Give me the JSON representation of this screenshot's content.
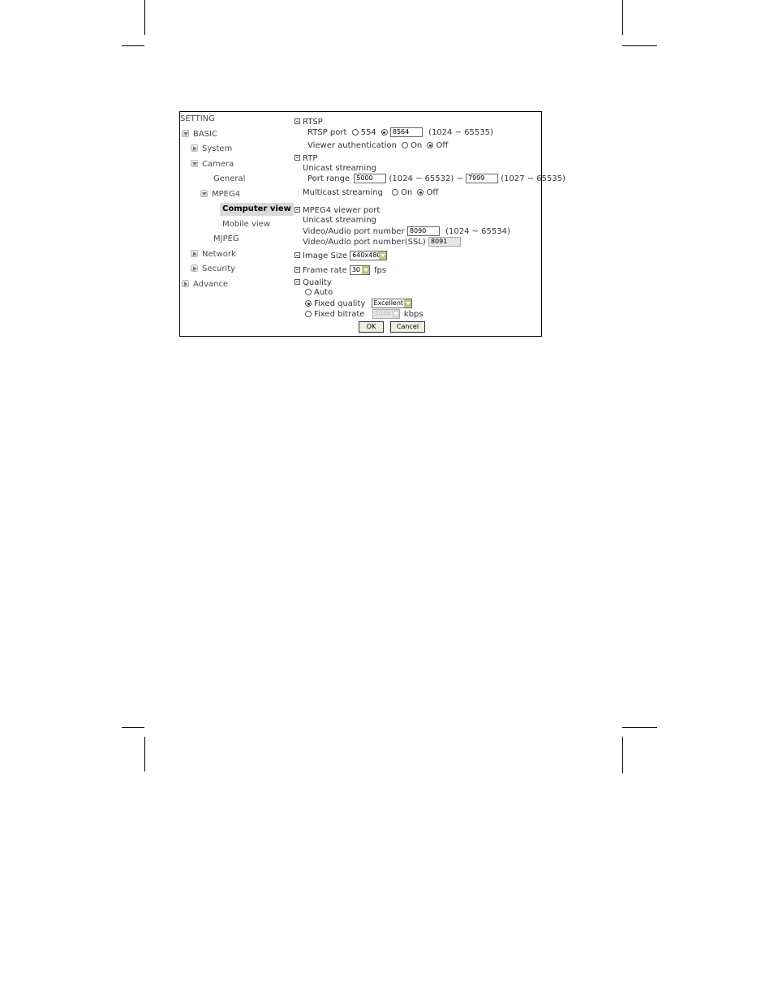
{
  "sidebar": {
    "title": "SETTING",
    "items": [
      {
        "label": "BASIC"
      },
      {
        "label": "System"
      },
      {
        "label": "Camera"
      },
      {
        "label": "General"
      },
      {
        "label": "MPEG4"
      },
      {
        "label": "Computer view"
      },
      {
        "label": "Mobile view"
      },
      {
        "label": "MJPEG"
      },
      {
        "label": "Network"
      },
      {
        "label": "Security"
      },
      {
        "label": "Advance"
      }
    ]
  },
  "rtsp": {
    "heading": "RTSP",
    "port_label": "RTSP port",
    "default_port": "554",
    "port_value": "8564",
    "port_range": "(1024 ~ 65535)",
    "auth_label": "Viewer authentication",
    "on_label": "On",
    "off_label": "Off"
  },
  "rtp": {
    "heading": "RTP",
    "unicast_label": "Unicast streaming",
    "port_range_label": "Port range",
    "port_from": "5000",
    "range1": "(1024 ~ 65532) ~",
    "port_to": "7999",
    "range2": "(1027 ~ 65535)",
    "multicast_label": "Multicast streaming",
    "on_label": "On",
    "off_label": "Off"
  },
  "viewer_port": {
    "heading": "MPEG4 viewer port",
    "unicast_label": "Unicast streaming",
    "av_label": "Video/Audio port number",
    "av_value": "8090",
    "av_range": "(1024 ~ 65534)",
    "ssl_label": "Video/Audio port number(SSL)",
    "ssl_value": "8091"
  },
  "image_size": {
    "label": "Image Size",
    "value": "640x480"
  },
  "frame_rate": {
    "label": "Frame rate",
    "value": "30",
    "unit": "fps"
  },
  "quality": {
    "heading": "Quality",
    "auto_label": "Auto",
    "fixed_label": "Fixed quality",
    "fixed_value": "Excellent",
    "bitrate_label": "Fixed bitrate",
    "bitrate_value": "2048",
    "bitrate_unit": "kbps"
  },
  "buttons": {
    "ok": "OK",
    "cancel": "Cancel"
  }
}
